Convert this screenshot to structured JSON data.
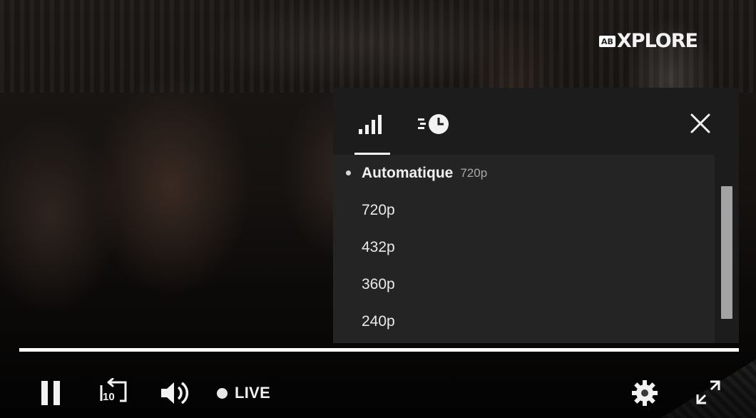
{
  "brand": {
    "badge": "AB",
    "name": "XPLORE"
  },
  "settings_panel": {
    "tabs": [
      {
        "name": "quality",
        "icon": "signal-bars-icon",
        "active": true
      },
      {
        "name": "speed",
        "icon": "playback-speed-icon",
        "active": false
      }
    ],
    "close_icon": "close-icon",
    "options": [
      {
        "label": "Automatique",
        "sublabel": "720p",
        "selected": true
      },
      {
        "label": "720p",
        "selected": false
      },
      {
        "label": "432p",
        "selected": false
      },
      {
        "label": "360p",
        "selected": false
      },
      {
        "label": "240p",
        "selected": false
      }
    ]
  },
  "progress": {
    "fraction": 1.0
  },
  "controls": {
    "pause_icon": "pause-icon",
    "replay_label": "10",
    "replay_icon": "replay-10-icon",
    "volume_icon": "volume-icon",
    "live_label": "LIVE",
    "settings_icon": "gear-icon",
    "fullscreen_icon": "fullscreen-icon"
  },
  "colors": {
    "panel_bg": "#1c1c1c",
    "options_bg": "#242424",
    "text": "#eaeaea",
    "progress": "#ffffff"
  }
}
